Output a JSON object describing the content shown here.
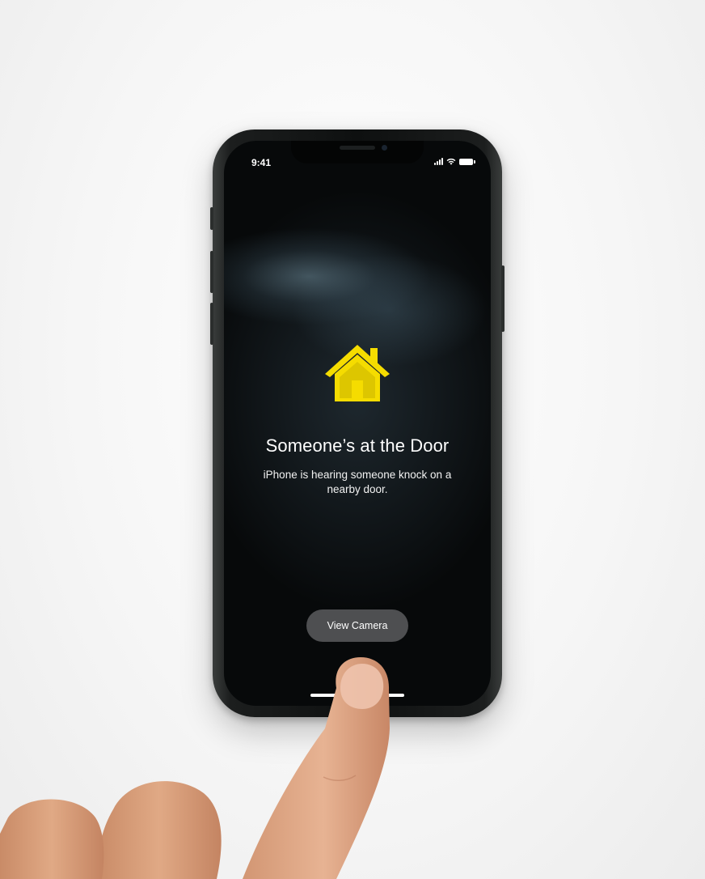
{
  "status_bar": {
    "time": "9:41",
    "signal_icon": "cellular-signal-icon",
    "wifi_icon": "wifi-icon",
    "battery_icon": "battery-icon"
  },
  "alert": {
    "icon": "home-icon",
    "icon_color": "#f5dc00",
    "title": "Someone’s at the Door",
    "message": "iPhone is hearing someone knock on a nearby door."
  },
  "actions": {
    "view_camera_label": "View Camera"
  },
  "colors": {
    "screen_background": "#07090a",
    "button_background": "#5a5c5e",
    "text": "#ffffff"
  }
}
